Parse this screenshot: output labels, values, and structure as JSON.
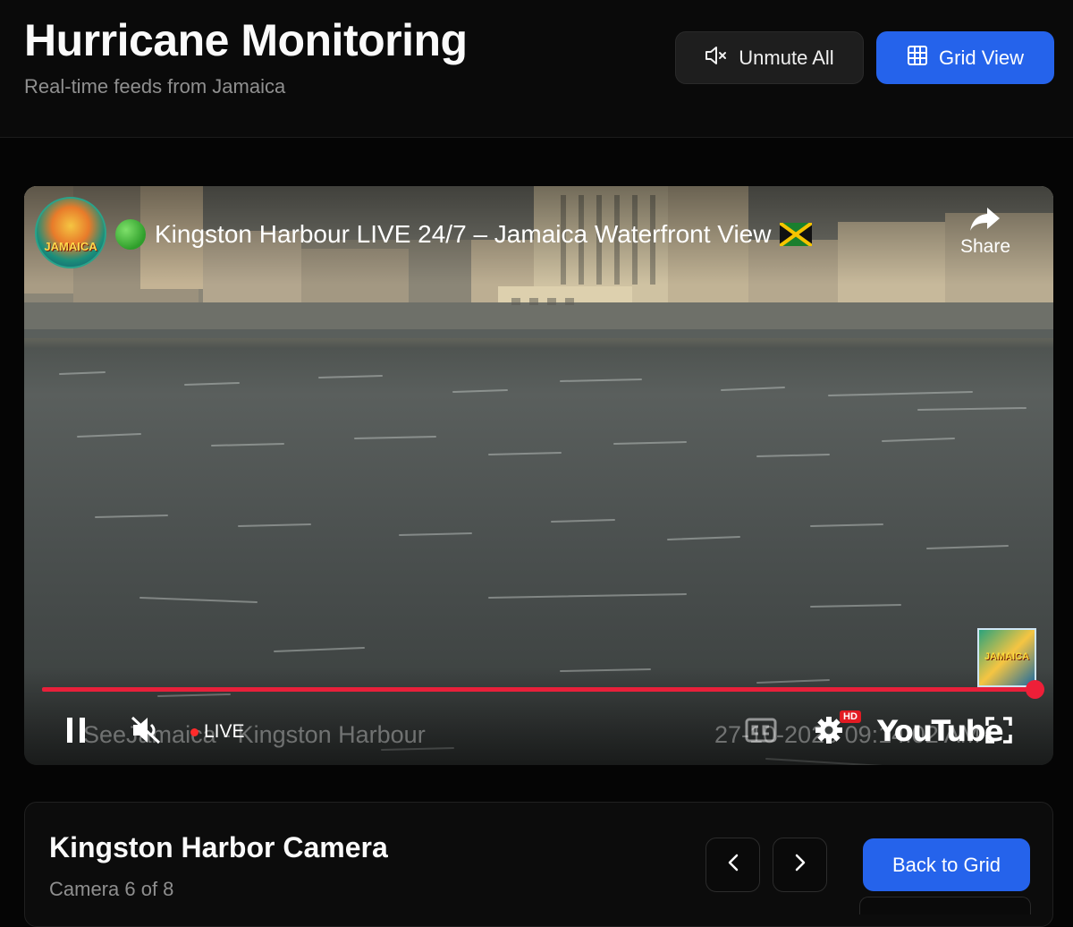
{
  "header": {
    "title": "Hurricane Monitoring",
    "subtitle": "Real-time feeds from Jamaica",
    "unmute_label": "Unmute All",
    "grid_label": "Grid View"
  },
  "player": {
    "video_title": "Kingston Harbour LIVE 24/7 – Jamaica Waterfront View",
    "channel_logo_text": "JAMAICA",
    "share_label": "Share",
    "live_label": "LIVE",
    "overlay_channel": "SeeJamaica - Kingston Harbour",
    "overlay_timestamp": "27-10-2025 09:14:02 AM",
    "hd_badge": "HD",
    "youtube_label": "YouTube",
    "corner_logo_text": "JAMAICA",
    "progress_fraction": 1.0,
    "icons": {
      "pause": "pause-icon",
      "mute": "muted-speaker-icon",
      "captions": "captions-icon",
      "settings": "gear-icon",
      "fullscreen": "fullscreen-icon",
      "share": "share-arrow-icon"
    }
  },
  "camera": {
    "name": "Kingston Harbor Camera",
    "count_text": "Camera 6 of 8",
    "back_label": "Back to Grid"
  },
  "colors": {
    "accent": "#2563eb",
    "progress": "#e8203a",
    "background": "#050505"
  }
}
